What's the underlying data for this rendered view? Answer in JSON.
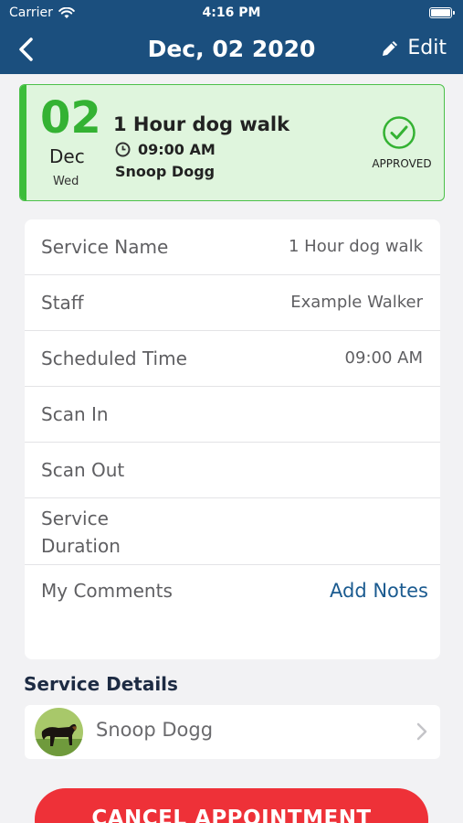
{
  "status_bar": {
    "carrier": "Carrier",
    "time": "4:16 PM"
  },
  "nav": {
    "title": "Dec, 02 2020",
    "edit_label": "Edit"
  },
  "appointment": {
    "day": "02",
    "month": "Dec",
    "weekday": "Wed",
    "service": "1 Hour dog walk",
    "time": "09:00 AM",
    "pet": "Snoop Dogg",
    "status": "APPROVED"
  },
  "details": {
    "service_name": {
      "label": "Service Name",
      "value": "1 Hour dog walk"
    },
    "staff": {
      "label": "Staff",
      "value": "Example Walker"
    },
    "scheduled_time": {
      "label": "Scheduled Time",
      "value": "09:00 AM"
    },
    "scan_in": {
      "label": "Scan In",
      "value": ""
    },
    "scan_out": {
      "label": "Scan Out",
      "value": ""
    },
    "service_duration": {
      "label_line1": "Service",
      "label_line2": "Duration"
    },
    "comments": {
      "label": "My Comments",
      "action": "Add Notes"
    }
  },
  "service_details": {
    "title": "Service Details",
    "pet_name": "Snoop Dogg"
  },
  "cancel_label": "CANCEL APPOINTMENT",
  "icons": [
    "wifi-icon",
    "battery-icon",
    "back-chevron-icon",
    "pencil-icon",
    "clock-icon",
    "check-circle-icon",
    "chevron-right-icon"
  ],
  "colors": {
    "header": "#1b4f7e",
    "approved": "#34b233",
    "approved_bg": "#dff5dd",
    "link": "#1b5b90",
    "cancel": "#ee3138"
  }
}
